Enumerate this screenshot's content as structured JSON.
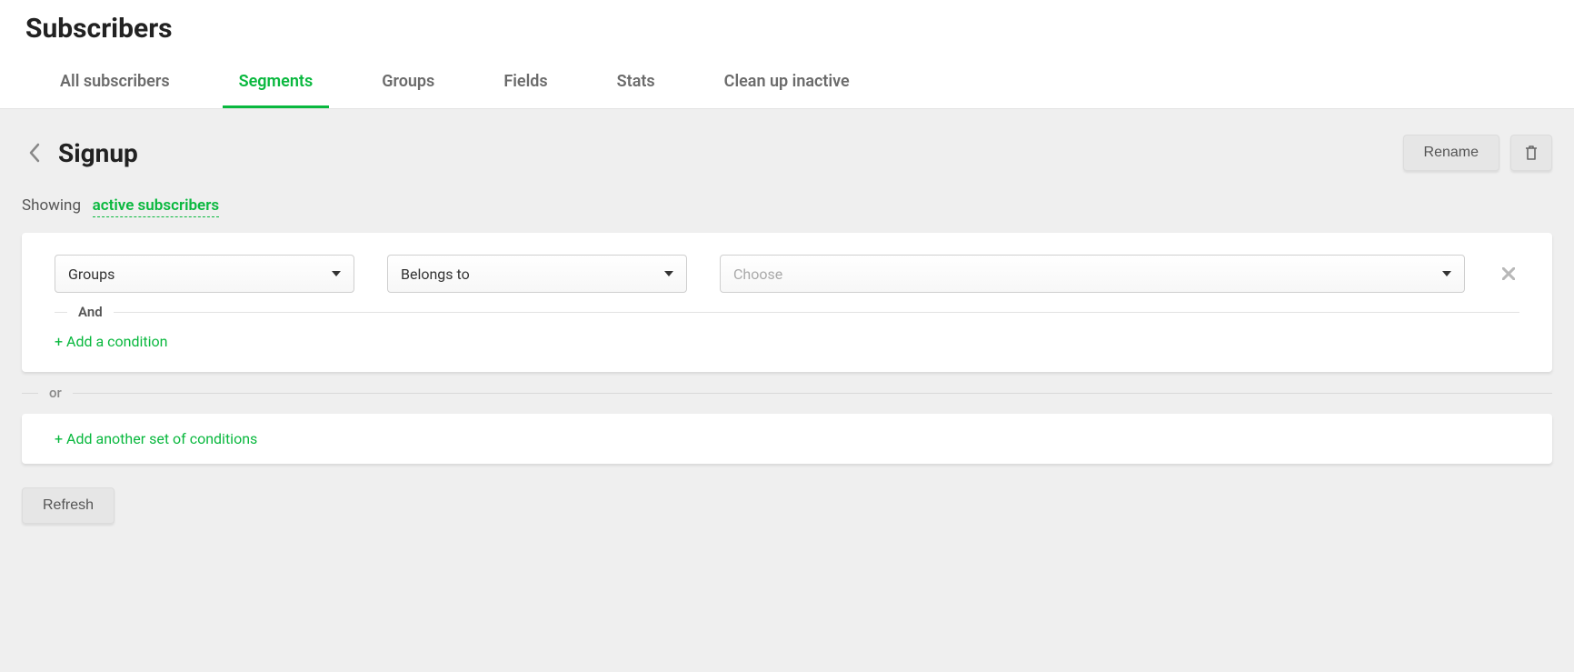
{
  "header": {
    "title": "Subscribers",
    "tabs": [
      {
        "label": "All subscribers"
      },
      {
        "label": "Segments"
      },
      {
        "label": "Groups"
      },
      {
        "label": "Fields"
      },
      {
        "label": "Stats"
      },
      {
        "label": "Clean up inactive"
      }
    ],
    "active_tab": "Segments"
  },
  "segment": {
    "name": "Signup",
    "rename_label": "Rename"
  },
  "showing": {
    "prefix": "Showing",
    "link": "active subscribers"
  },
  "builder": {
    "condition": {
      "field_select": "Groups",
      "operator_select": "Belongs to",
      "value_placeholder": "Choose"
    },
    "and_label": "And",
    "add_condition": "+ Add a condition",
    "or_label": "or",
    "add_set": "+ Add another set of conditions"
  },
  "actions": {
    "refresh": "Refresh"
  }
}
